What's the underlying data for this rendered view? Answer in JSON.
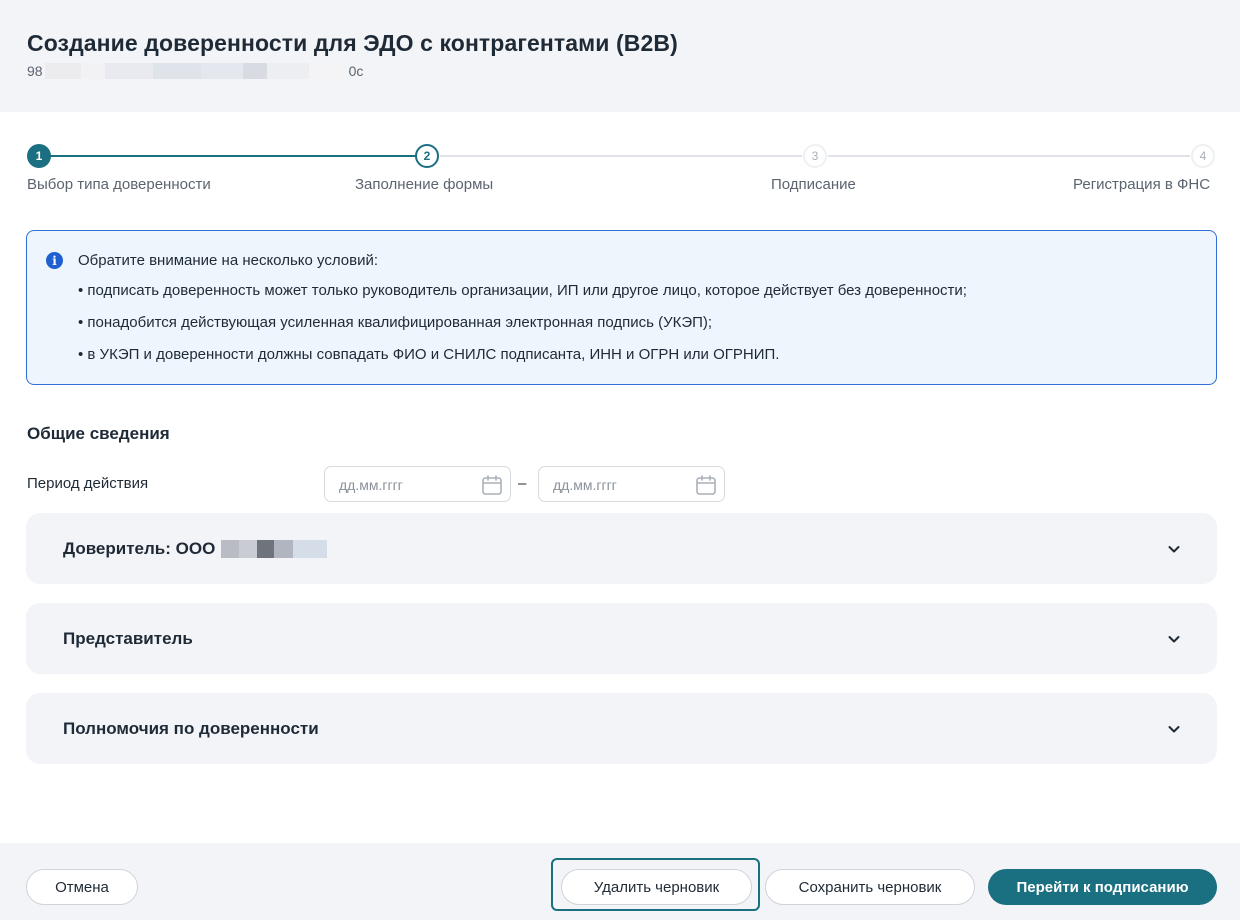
{
  "header": {
    "title": "Создание доверенности для ЭДО с контрагентами (B2B)",
    "doc_id_prefix": "98",
    "doc_id_suffix": "0c"
  },
  "stepper": {
    "steps": [
      {
        "number": "1",
        "label": "Выбор типа доверенности",
        "state": "completed"
      },
      {
        "number": "2",
        "label": "Заполнение формы",
        "state": "current"
      },
      {
        "number": "3",
        "label": "Подписание",
        "state": "pending"
      },
      {
        "number": "4",
        "label": "Регистрация в ФНС",
        "state": "pending"
      }
    ]
  },
  "notice": {
    "heading": "Обратите внимание на несколько условий:",
    "items": [
      "• подписать доверенность может только руководитель организации, ИП или другое лицо, которое действует без доверенности;",
      "• понадобится действующая усиленная квалифицированная электронная подпись (УКЭП);",
      "• в УКЭП и доверенности должны совпадать ФИО и СНИЛС подписанта, ИНН и ОГРН или ОГРНИП."
    ]
  },
  "general": {
    "section_title": "Общие сведения",
    "period_label": "Период действия",
    "date_from_placeholder": "дд.мм.гггг",
    "date_to_placeholder": "дд.мм.гггг",
    "separator": "–"
  },
  "accordions": [
    {
      "title": "Доверитель: ООО",
      "expanded": false
    },
    {
      "title": "Представитель",
      "expanded": false
    },
    {
      "title": "Полномочия по доверенности",
      "expanded": false
    }
  ],
  "footer": {
    "cancel_label": "Отмена",
    "delete_draft_label": "Удалить черновик",
    "save_draft_label": "Сохранить черновик",
    "proceed_label": "Перейти к подписанию"
  },
  "colors": {
    "accent": "#1a6f80",
    "info_border": "#2f6fd6",
    "info_bg": "#eef5fc",
    "panel_bg": "#f3f4f7"
  }
}
